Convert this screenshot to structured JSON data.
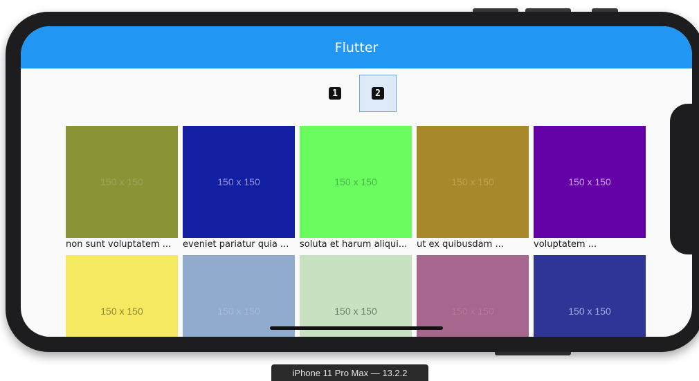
{
  "app": {
    "title": "Flutter"
  },
  "pagination": {
    "pages": [
      {
        "label": "1",
        "selected": false
      },
      {
        "label": "2",
        "selected": true
      }
    ]
  },
  "tiles": [
    {
      "image_text": "150 x 150",
      "caption": "non sunt voluptatem ...",
      "bg": "#8a9436",
      "fg": "#9aa556"
    },
    {
      "image_text": "150 x 150",
      "caption": "eveniet pariatur quia ...",
      "bg": "#131fa3",
      "fg": "#8f95d6"
    },
    {
      "image_text": "150 x 150",
      "caption": "soluta et harum aliqui...",
      "bg": "#6afd60",
      "fg": "#4fb648"
    },
    {
      "image_text": "150 x 150",
      "caption": "ut ex quibusdam ...",
      "bg": "#a9882b",
      "fg": "#bfa14e"
    },
    {
      "image_text": "150 x 150",
      "caption": "voluptatem ...",
      "bg": "#6300a6",
      "fg": "#c6a4e6"
    },
    {
      "image_text": "150 x 150",
      "caption": "",
      "bg": "#f5e961",
      "fg": "#8e8638"
    },
    {
      "image_text": "150 x 150",
      "caption": "",
      "bg": "#91abce",
      "fg": "#a3bad8"
    },
    {
      "image_text": "150 x 150",
      "caption": "",
      "bg": "#c8e2c1",
      "fg": "#6d7d68"
    },
    {
      "image_text": "150 x 150",
      "caption": "",
      "bg": "#a6668d",
      "fg": "#b17a9b"
    },
    {
      "image_text": "150 x 150",
      "caption": "",
      "bg": "#2f3597",
      "fg": "#a9acdc"
    }
  ],
  "simulator": {
    "device_label": "iPhone 11 Pro Max — 13.2.2"
  }
}
